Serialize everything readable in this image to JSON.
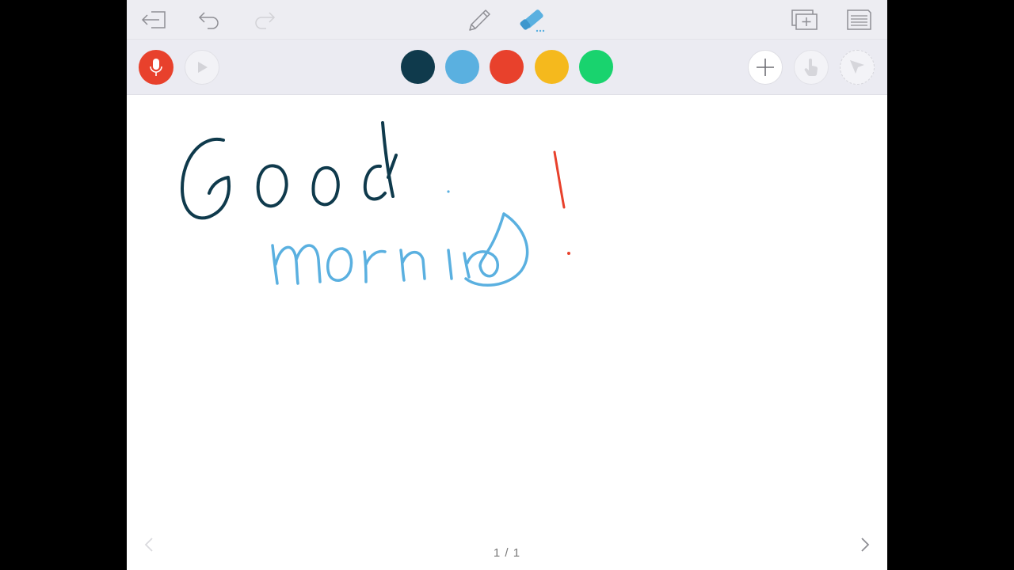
{
  "toolbar": {
    "icons": [
      "exit-icon",
      "undo-icon",
      "redo-icon",
      "pencil-icon",
      "eraser-icon",
      "add-slide-icon",
      "slides-list-icon"
    ]
  },
  "controls": {
    "icons": [
      "microphone-icon",
      "play-icon",
      "plus-icon",
      "hand-icon",
      "pointer-icon"
    ],
    "record_color": "#e8412c"
  },
  "palette": {
    "colors": [
      "#0f3a4c",
      "#5ab0e0",
      "#e8412c",
      "#f5b91d",
      "#19d36e"
    ]
  },
  "canvas": {
    "ink_colors": {
      "good": "#0f3a4c",
      "morning": "#5ab0e0",
      "exclamation": "#e8412c"
    }
  },
  "pager": {
    "indicator": "1 / 1"
  }
}
